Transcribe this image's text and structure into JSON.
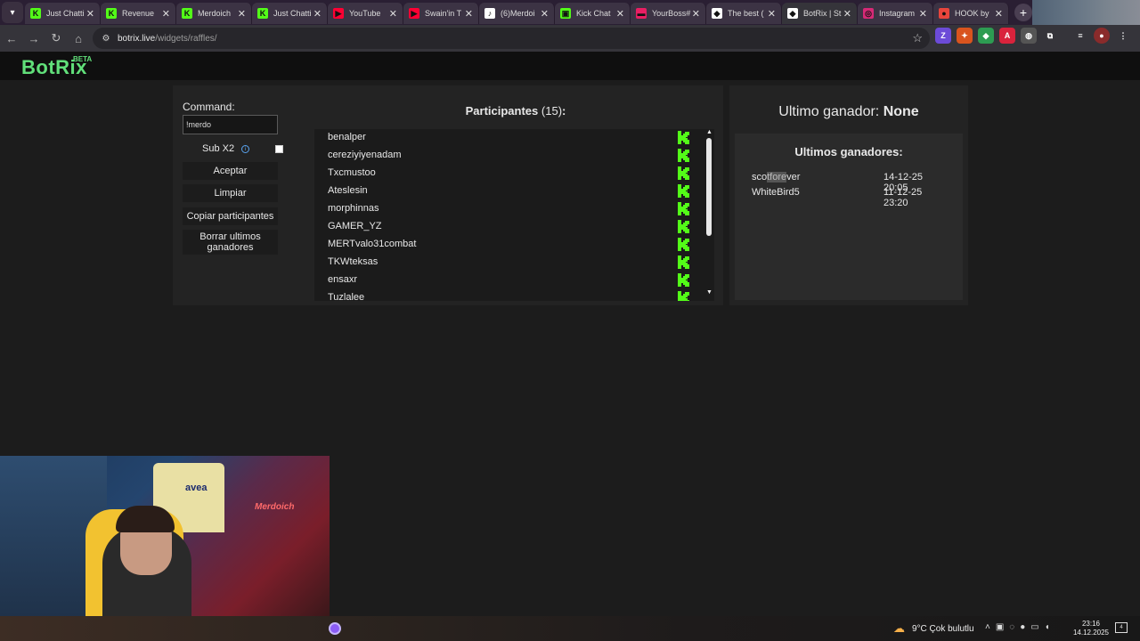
{
  "browser": {
    "tabs": [
      {
        "title": "Just Chatti",
        "fav": "K",
        "color": "#53fc18"
      },
      {
        "title": "Revenue",
        "fav": "K",
        "color": "#53fc18"
      },
      {
        "title": "Merdoich",
        "fav": "K",
        "color": "#53fc18"
      },
      {
        "title": "Just Chatti",
        "fav": "K",
        "color": "#53fc18"
      },
      {
        "title": "YouTube",
        "fav": "▶",
        "color": "#ff0033"
      },
      {
        "title": "Swain'in T",
        "fav": "▶",
        "color": "#ff0033"
      },
      {
        "title": "(6)Merdoi",
        "fav": "♪",
        "color": "#ffffff"
      },
      {
        "title": "Kick Chat",
        "fav": "▣",
        "color": "#53fc18"
      },
      {
        "title": "YourBoss#",
        "fav": "▬",
        "color": "#e91e63"
      },
      {
        "title": "The best (",
        "fav": "◆",
        "color": "#ffffff"
      },
      {
        "title": "BotRix | St",
        "fav": "◆",
        "color": "#ffffff",
        "active": true
      },
      {
        "title": "Instagram",
        "fav": "◎",
        "color": "#d62976"
      },
      {
        "title": "HOOK by",
        "fav": "●",
        "color": "#e8453c"
      }
    ],
    "url_host": "botrix.live",
    "url_path": "/widgets/raffles/"
  },
  "site": {
    "logo": "BotRix",
    "beta": "BETA"
  },
  "raffle": {
    "command_label": "Command:",
    "command_value": "!merdo",
    "sub_label": "Sub X2",
    "accept": "Aceptar",
    "clear": "Limpiar",
    "copy": "Copiar participantes",
    "delete": "Borrar ultimos ganadores",
    "participants_title": "Participantes",
    "participants_count": "(15)",
    "participants_colon": ":",
    "participants": [
      "benalper",
      "cereziyiyenadam",
      "Txcmustoo",
      "Ateslesin",
      "morphinnas",
      "GAMER_YZ",
      "MERTvalo31combat",
      "TKWteksas",
      "ensaxr",
      "Tuzlalee"
    ]
  },
  "winners": {
    "last_label": "Ultimo ganador:",
    "last_value": "None",
    "title": "Ultimos ganadores:",
    "list": [
      {
        "name_a": "sco",
        "name_b": "tfore",
        "name_c": "ver",
        "date": "14-12-25 20:05"
      },
      {
        "name_a": "WhiteBird5",
        "name_b": "",
        "name_c": "",
        "date": "11-12-25 23:20"
      }
    ]
  },
  "webcam": {
    "jersey_text": "avea",
    "neon_text": "Merdoich"
  },
  "taskbar": {
    "weather": "9°C  Çok bulutlu",
    "time": "23:16",
    "date": "14.12.2025",
    "notif_count": "4"
  },
  "colors": {
    "brand": "#61e07a",
    "kick": "#53fc18"
  }
}
